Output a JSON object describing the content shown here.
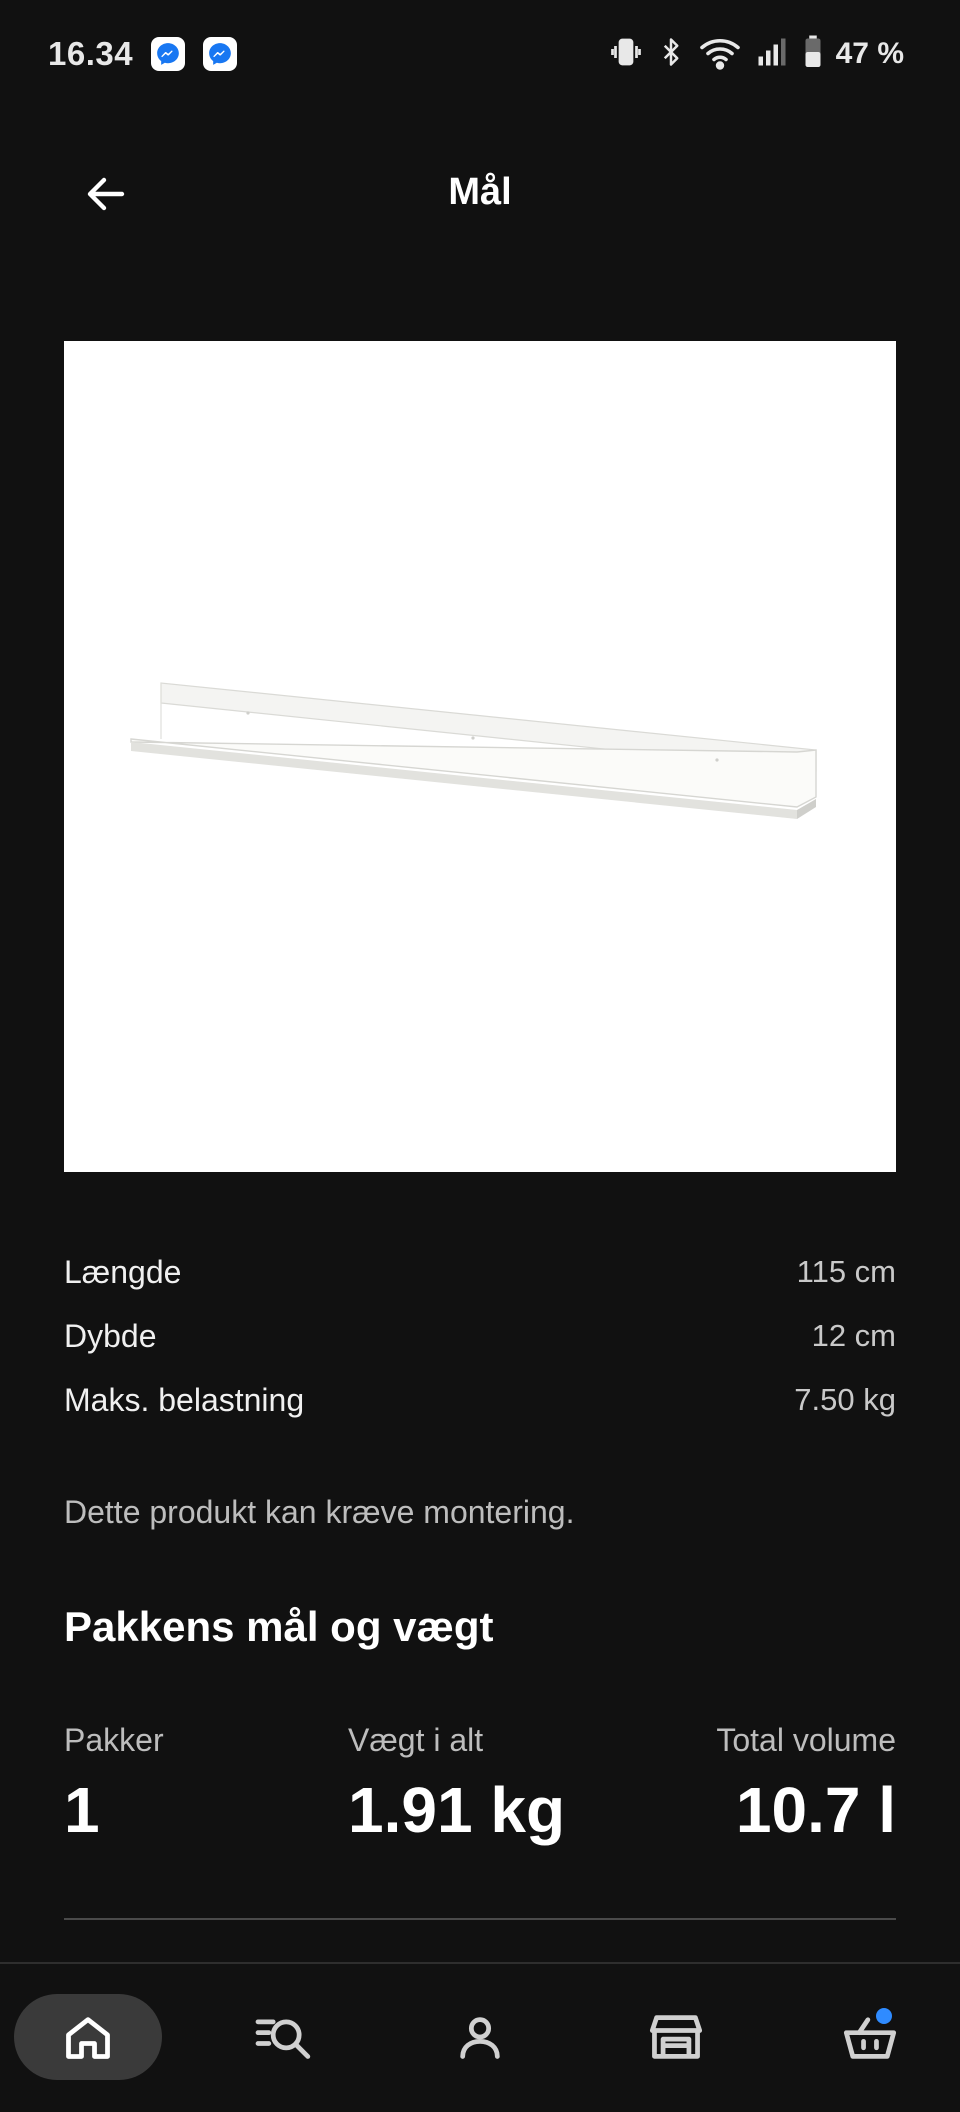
{
  "status_bar": {
    "time": "16.34",
    "battery": "47 %"
  },
  "header": {
    "title": "Mål"
  },
  "specs": [
    {
      "label": "Længde",
      "value": "115 cm"
    },
    {
      "label": "Dybde",
      "value": "12 cm"
    },
    {
      "label": "Maks. belastning",
      "value": "7.50 kg"
    }
  ],
  "note": "Dette produkt kan kræve montering.",
  "package": {
    "title": "Pakkens mål og vægt",
    "items": [
      {
        "label": "Pakker",
        "value": "1"
      },
      {
        "label": "Vægt i alt",
        "value": "1.91 kg"
      },
      {
        "label": "Total volume",
        "value": "10.7 l"
      }
    ]
  },
  "bottom_nav": {
    "items": [
      "home-icon",
      "search-list-icon",
      "profile-icon",
      "store-icon",
      "cart-icon"
    ],
    "active": "home-icon",
    "cart_badge_color": "#2f8bff"
  }
}
